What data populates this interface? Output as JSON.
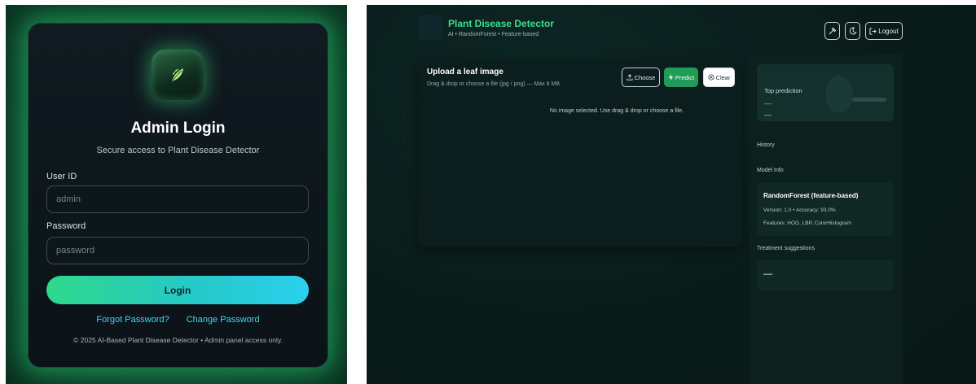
{
  "login": {
    "title": "Admin Login",
    "subtitle": "Secure access to Plant Disease Detector",
    "user_label": "User ID",
    "user_placeholder": "admin",
    "password_label": "Password",
    "password_placeholder": "password",
    "login_button": "Login",
    "forgot_link": "Forgot Password?",
    "change_link": "Change Password",
    "footer": "© 2025 AI-Based Plant Disease Detector • Admin panel access only.",
    "logo_icon": "leaf-icon"
  },
  "detector": {
    "header": {
      "title": "Plant Disease Detector",
      "subtitle": "AI • RandomForest • Feature-based",
      "pin_icon": "pin-icon",
      "moon_icon": "moon-icon",
      "logout_label": "Logout",
      "logout_icon": "logout-icon"
    },
    "upload": {
      "title": "Upload a leaf image",
      "hint": "Drag & drop or choose a file (jpg / png) — Max 8 MB",
      "choose_label": "Choose",
      "predict_label": "Predict",
      "clear_label": "Clear",
      "empty_text": "No image selected. Use drag & drop or choose a file."
    },
    "sidebar": {
      "top_prediction_title": "Top prediction",
      "top_prediction_value": "—",
      "top_prediction_confidence": "—",
      "history_label": "History",
      "model_info_label": "Model Info",
      "model_name": "RandomForest (feature-based)",
      "model_version": "Version: 1.0 • Accuracy: 93.0%",
      "model_features": "Features: HOG, LBP, ColorHistogram",
      "treatment_label": "Treatment suggestions",
      "treatment_value": "—"
    }
  },
  "colors": {
    "accent_green": "#3fdc8e",
    "predict_green": "#1f9c55",
    "link_cyan": "#3fd7e8"
  }
}
